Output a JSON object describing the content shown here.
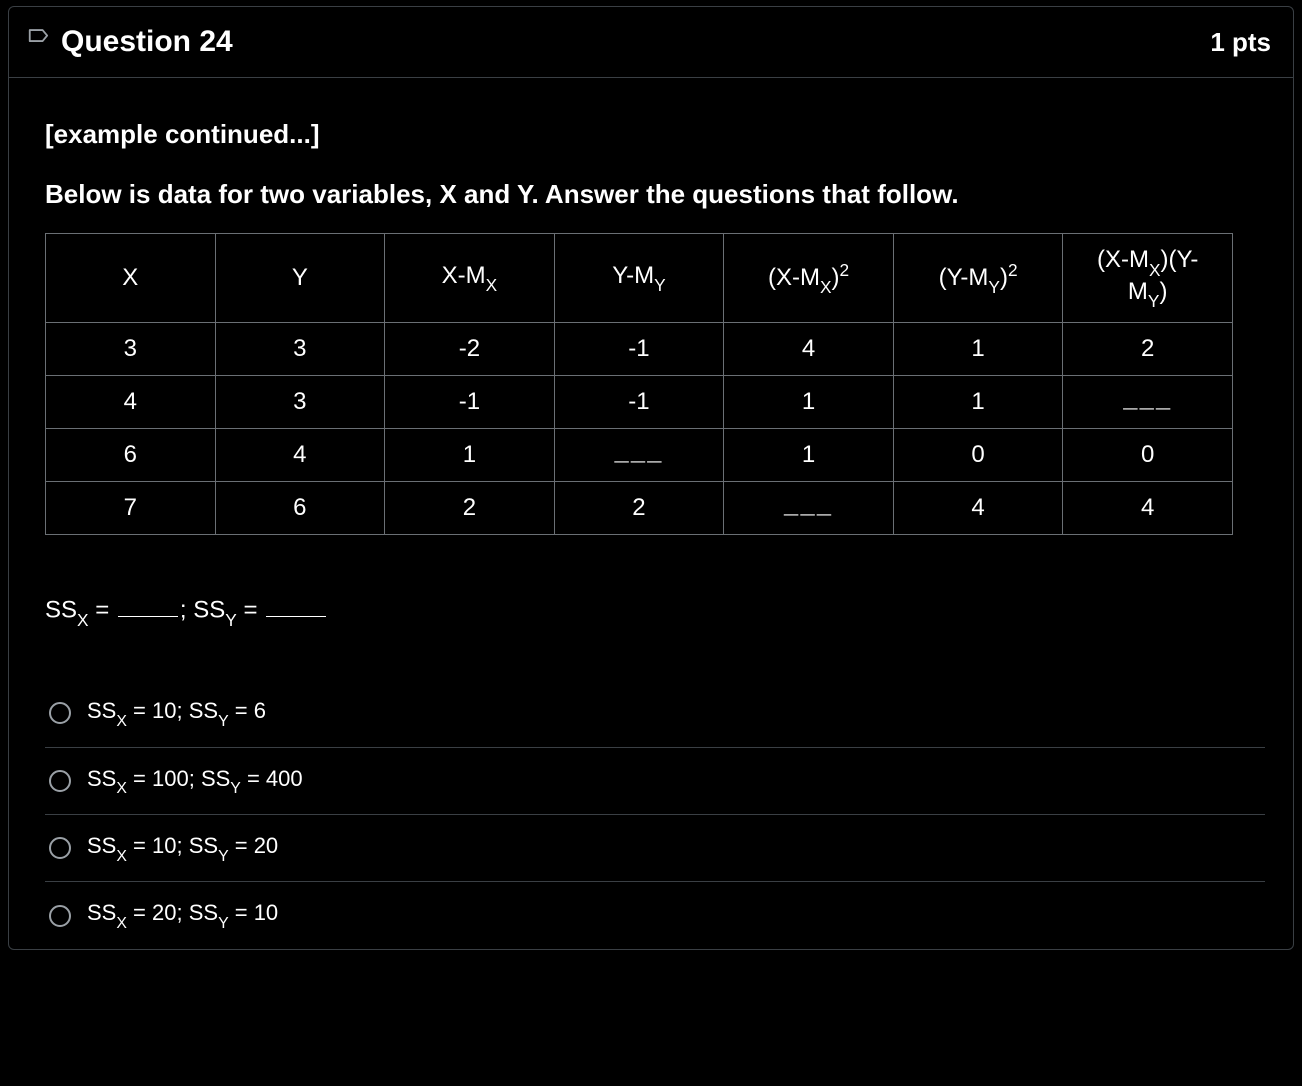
{
  "header": {
    "title": "Question 24",
    "points": "1 pts"
  },
  "prompt": {
    "line1": "[example continued...]",
    "line2": "Below is data for two variables, X and Y.  Answer the questions that follow."
  },
  "table": {
    "headers": {
      "c0": "X",
      "c1": "Y",
      "c2_pre": "X-M",
      "c2_sub": "X",
      "c3_pre": "Y-M",
      "c3_sub": "Y",
      "c4_pre": "(X-M",
      "c4_sub": "X",
      "c4_post": ")",
      "c4_sup": "2",
      "c5_pre": "(Y-M",
      "c5_sub": "Y",
      "c5_post": ")",
      "c5_sup": "2",
      "c6_pre": "(X-M",
      "c6_sub1": "X",
      "c6_mid": ")(Y-",
      "c6_line2_pre": "M",
      "c6_sub2": "Y",
      "c6_line2_post": ")"
    },
    "rows": [
      {
        "c0": "3",
        "c1": "3",
        "c2": "-2",
        "c3": "-1",
        "c4": "4",
        "c5": "1",
        "c6": "2"
      },
      {
        "c0": "4",
        "c1": "3",
        "c2": "-1",
        "c3": "-1",
        "c4": "1",
        "c5": "1",
        "c6": "___"
      },
      {
        "c0": "6",
        "c1": "4",
        "c2": "1",
        "c3": "___",
        "c4": "1",
        "c5": "0",
        "c6": "0"
      },
      {
        "c0": "7",
        "c1": "6",
        "c2": "2",
        "c3": "2",
        "c4": "___",
        "c5": "4",
        "c6": "4"
      }
    ]
  },
  "fill_prompt": {
    "ss1_pre": "SS",
    "ss1_sub": "X",
    "eq": " = ",
    "sep": "; ",
    "ss2_pre": "SS",
    "ss2_sub": "Y"
  },
  "options": [
    {
      "ssx_pre": "SS",
      "ssx_sub": "X",
      "ssx_val": " = 10; ",
      "ssy_pre": "SS",
      "ssy_sub": "Y",
      "ssy_val": " = 6"
    },
    {
      "ssx_pre": "SS",
      "ssx_sub": "X",
      "ssx_val": " = 100; ",
      "ssy_pre": "SS",
      "ssy_sub": "Y",
      "ssy_val": " = 400"
    },
    {
      "ssx_pre": "SS",
      "ssx_sub": "X",
      "ssx_val": " = 10; ",
      "ssy_pre": "SS",
      "ssy_sub": "Y",
      "ssy_val": " = 20"
    },
    {
      "ssx_pre": "SS",
      "ssx_sub": "X",
      "ssx_val": " = 20; ",
      "ssy_pre": "SS",
      "ssy_sub": "Y",
      "ssy_val": " = 10"
    }
  ]
}
